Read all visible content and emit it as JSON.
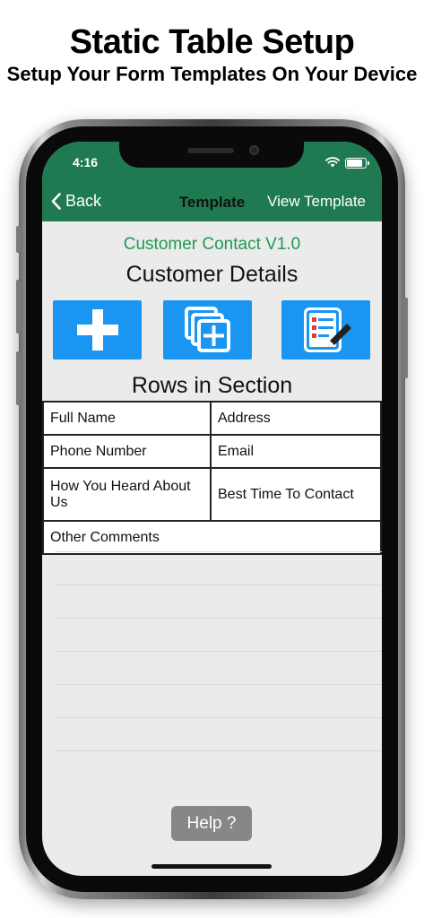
{
  "promo": {
    "title": "Static Table Setup",
    "subtitle": "Setup Your Form Templates On Your Device"
  },
  "status_bar": {
    "time": "4:16",
    "icons": [
      "wifi-icon",
      "battery-icon"
    ]
  },
  "navbar": {
    "back_label": "Back",
    "title": "Template",
    "right_label": "View Template",
    "background": "#1f7a52"
  },
  "content": {
    "template_name": "Customer Contact V1.0",
    "section_title": "Customer Details",
    "toolbar": [
      {
        "icon": "plus-icon"
      },
      {
        "icon": "duplicate-add-icon"
      },
      {
        "icon": "edit-list-icon"
      }
    ],
    "rows_title": "Rows in Section",
    "rows": [
      [
        "Full Name",
        "Address"
      ],
      [
        "Phone Number",
        "Email"
      ],
      [
        "How You Heard About Us",
        "Best Time To Contact"
      ],
      [
        "Other Comments"
      ]
    ]
  },
  "help_label": "Help ?",
  "colors": {
    "accent": "#1a95f2",
    "template_name": "#1f9a52",
    "help_button": "#878787"
  }
}
